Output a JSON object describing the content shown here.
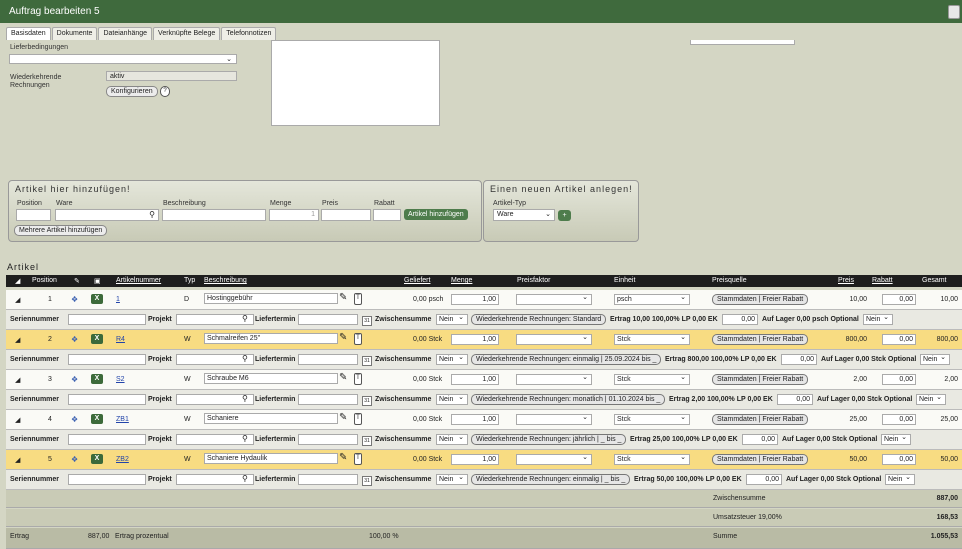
{
  "window": {
    "title": "Auftrag bearbeiten 5"
  },
  "tabs": [
    "Basisdaten",
    "Dokumente",
    "Dateianhänge",
    "Verknüpfte Belege",
    "Telefonnotizen"
  ],
  "form": {
    "lieferbedingungen_label": "Lieferbedingungen",
    "wiederkehrende_label_1": "Wiederkehrende",
    "wiederkehrende_label_2": "Rechnungen",
    "wiederkehrende_value": "aktiv",
    "konfigurieren": "Konfigurieren",
    "help": "?"
  },
  "add_panel": {
    "title": "Artikel hier hinzufügen!",
    "position": "Position",
    "ware": "Ware",
    "beschreibung": "Beschreibung",
    "menge": "Menge",
    "menge_value": "1",
    "preis": "Preis",
    "rabatt": "Rabatt",
    "add_button": "Artikel hinzufügen",
    "multi_button": "Mehrere Artikel hinzufügen"
  },
  "new_panel": {
    "title": "Einen neuen Artikel anlegen!",
    "artikel_typ": "Artikel-Typ",
    "typ_value": "Ware",
    "plus": "+"
  },
  "articles_section": "Artikel",
  "table_headers": {
    "position": "Position",
    "artikelnummer": "Artikelnummer",
    "typ": "Typ",
    "beschreibung": "Beschreibung",
    "geliefert": "Geliefert",
    "menge": "Menge",
    "preisfaktor": "Preisfaktor",
    "einheit": "Einheit",
    "preisquelle": "Preisquelle",
    "preis": "Preis",
    "rabatt": "Rabatt",
    "gesamt": "Gesamt"
  },
  "sub_labels": {
    "seriennummer": "Seriennummer",
    "projekt": "Projekt",
    "liefertermin": "Liefertermin",
    "zwischensumme": "Zwischensumme",
    "nein": "Nein",
    "optional_nein": "Nein",
    "stamm": "Stammdaten | Freier Rabatt",
    "pencil": "✎",
    "t": "T",
    "x": "X",
    "cal": "31"
  },
  "rows": [
    {
      "pos": "1",
      "nr": "1",
      "typ": "D",
      "beschreibung": "Hostinggebühr",
      "geliefert": "0,00 psch",
      "menge": "1,00",
      "einheit": "psch",
      "preis": "10,00",
      "rabatt": "0,00",
      "gesamt": "10,00",
      "wiederkehrend": "Wiederkehrende Rechnungen: Standard",
      "ertrag": "Ertrag 10,00 100,00% LP 0,00 EK",
      "ek": "0,00",
      "lager": "Auf Lager 0,00 psch Optional"
    },
    {
      "pos": "2",
      "nr": "R4",
      "typ": "W",
      "beschreibung": "Schmalreifen 25\"",
      "geliefert": "0,00 Stck",
      "menge": "1,00",
      "einheit": "Stck",
      "preis": "800,00",
      "rabatt": "0,00",
      "gesamt": "800,00",
      "wiederkehrend": "Wiederkehrende Rechnungen: einmalig | 25.09.2024 bis _",
      "ertrag": "Ertrag 800,00 100,00% LP 0,00 EK",
      "ek": "0,00",
      "lager": "Auf Lager 0,00 Stck Optional"
    },
    {
      "pos": "3",
      "nr": "S2",
      "typ": "W",
      "beschreibung": "Schraube M6",
      "geliefert": "0,00 Stck",
      "menge": "1,00",
      "einheit": "Stck",
      "preis": "2,00",
      "rabatt": "0,00",
      "gesamt": "2,00",
      "wiederkehrend": "Wiederkehrende Rechnungen: monatlich | 01.10.2024 bis _",
      "ertrag": "Ertrag 2,00 100,00% LP 0,00 EK",
      "ek": "0,00",
      "lager": "Auf Lager 0,00 Stck Optional"
    },
    {
      "pos": "4",
      "nr": "ZB1",
      "typ": "W",
      "beschreibung": "Schaniere",
      "geliefert": "0,00 Stck",
      "menge": "1,00",
      "einheit": "Stck",
      "preis": "25,00",
      "rabatt": "0,00",
      "gesamt": "25,00",
      "wiederkehrend": "Wiederkehrende Rechnungen: jährlich | _ bis _",
      "ertrag": "Ertrag 25,00 100,00% LP 0,00 EK",
      "ek": "0,00",
      "lager": "Auf Lager 0,00 Stck Optional"
    },
    {
      "pos": "5",
      "nr": "ZB2",
      "typ": "W",
      "beschreibung": "Schaniere Hydaulik",
      "geliefert": "0,00 Stck",
      "menge": "1,00",
      "einheit": "Stck",
      "preis": "50,00",
      "rabatt": "0,00",
      "gesamt": "50,00",
      "wiederkehrend": "Wiederkehrende Rechnungen: einmalig | _ bis _",
      "ertrag": "Ertrag 50,00 100,00% LP 0,00 EK",
      "ek": "0,00",
      "lager": "Auf Lager 0,00 Stck Optional"
    }
  ],
  "summary": {
    "zwischensumme_label": "Zwischensumme",
    "zwischensumme_value": "887,00",
    "ust_label": "Umsatzsteuer 19,00%",
    "ust_value": "168,53",
    "ertrag_label": "Ertrag",
    "ertrag_value": "887,00",
    "ertrag_prozentual_label": "Ertrag prozentual",
    "ertrag_prozentual_value": "100,00 %",
    "summe_label": "Summe",
    "summe_value": "1.055,53"
  },
  "colors": {
    "header_green": "#3f6a3d",
    "row_yellow": "#f8dc82",
    "background": "#d4d6c4"
  }
}
